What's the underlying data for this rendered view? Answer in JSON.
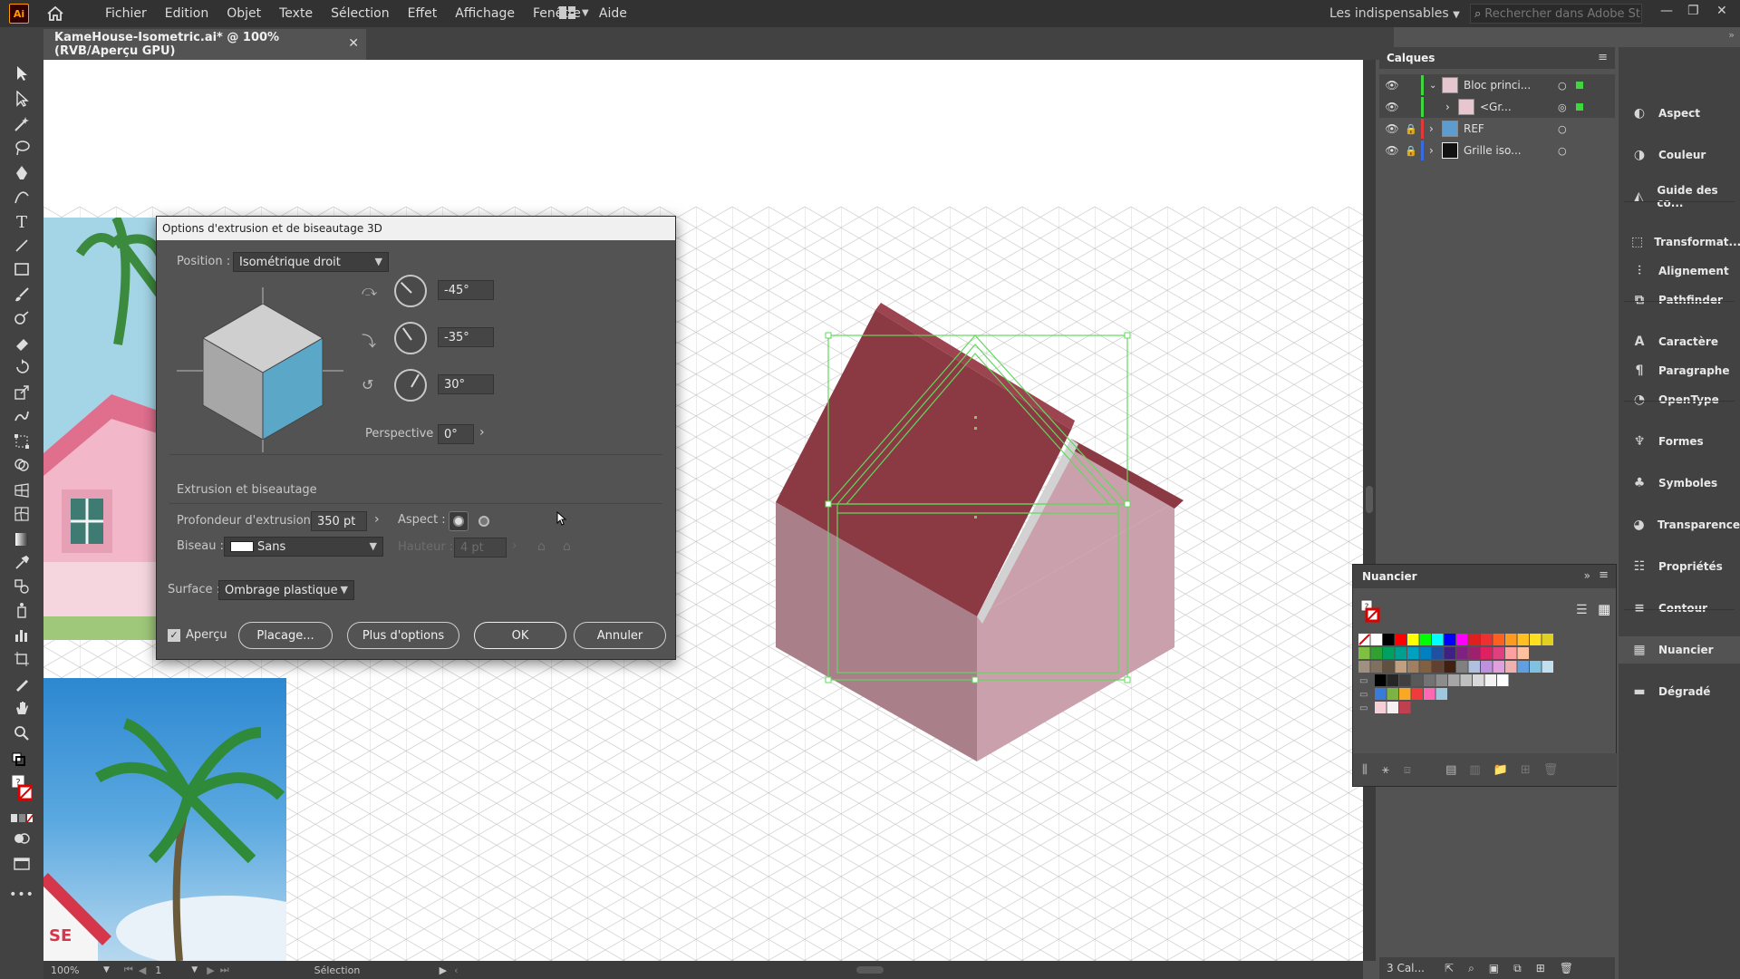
{
  "app": {
    "logo": "Ai"
  },
  "menu": [
    "Fichier",
    "Edition",
    "Objet",
    "Texte",
    "Sélection",
    "Effet",
    "Affichage",
    "Fenêtre",
    "Aide"
  ],
  "workspace": "Les indispensables",
  "search_placeholder": "Rechercher dans Adobe Stock",
  "document_tab": "KameHouse-Isometric.ai* @ 100% (RVB/Aperçu GPU)",
  "statusbar": {
    "zoom": "100%",
    "artboard": "1",
    "tool": "Sélection"
  },
  "dialog": {
    "title": "Options d'extrusion et de biseautage 3D",
    "position_label": "Position :",
    "position_value": "Isométrique droit",
    "rot_x": "-45°",
    "rot_y": "-35°",
    "rot_z": "30°",
    "perspective_label": "Perspective :",
    "perspective_value": "0°",
    "section_title": "Extrusion et biseautage",
    "depth_label": "Profondeur d'extrusion :",
    "depth_value": "350 pt",
    "aspect_label": "Aspect :",
    "bevel_label": "Biseau :",
    "bevel_value": "Sans",
    "height_label": "Hauteur :",
    "height_value": "4 pt",
    "surface_label": "Surface :",
    "surface_value": "Ombrage plastique",
    "preview_label": "Aperçu",
    "btn_placage": "Placage...",
    "btn_more": "Plus d'options",
    "btn_ok": "OK",
    "btn_cancel": "Annuler"
  },
  "layers": {
    "title": "Calques",
    "rows": [
      {
        "name": "Bloc princi...",
        "color": "#3fd63f"
      },
      {
        "name": "<Gr...",
        "color": "#3fd63f"
      },
      {
        "name": "REF",
        "color": "#e03a3a"
      },
      {
        "name": "Grille iso...",
        "color": "#3a6ae0"
      }
    ],
    "footer_count": "3 Cal..."
  },
  "swatches": {
    "title": "Nuancier"
  },
  "dock": [
    {
      "label": "Aspect",
      "icon": "aspect-icon"
    },
    {
      "label": "Couleur",
      "icon": "color-icon"
    },
    {
      "label": "Guide des co...",
      "icon": "color-guide-icon"
    },
    {
      "label": "Transformat...",
      "icon": "transform-icon"
    },
    {
      "label": "Alignement",
      "icon": "align-icon"
    },
    {
      "label": "Pathfinder",
      "icon": "pathfinder-icon"
    },
    {
      "label": "Caractère",
      "icon": "character-icon"
    },
    {
      "label": "Paragraphe",
      "icon": "paragraph-icon"
    },
    {
      "label": "OpenType",
      "icon": "opentype-icon"
    },
    {
      "label": "Formes",
      "icon": "brushes-icon"
    },
    {
      "label": "Symboles",
      "icon": "symbols-icon"
    },
    {
      "label": "Transparence",
      "icon": "transparency-icon"
    },
    {
      "label": "Propriétés",
      "icon": "properties-icon"
    },
    {
      "label": "Contour",
      "icon": "stroke-icon"
    },
    {
      "label": "Nuancier",
      "icon": "swatches-icon"
    },
    {
      "label": "Dégradé",
      "icon": "gradient-icon"
    }
  ],
  "colors": {
    "roof": "#8b3a44",
    "wall_light": "#c9a0ab",
    "wall_dark": "#a9808a",
    "selection": "#62d85e",
    "cube_blue": "#5aa7c7"
  }
}
